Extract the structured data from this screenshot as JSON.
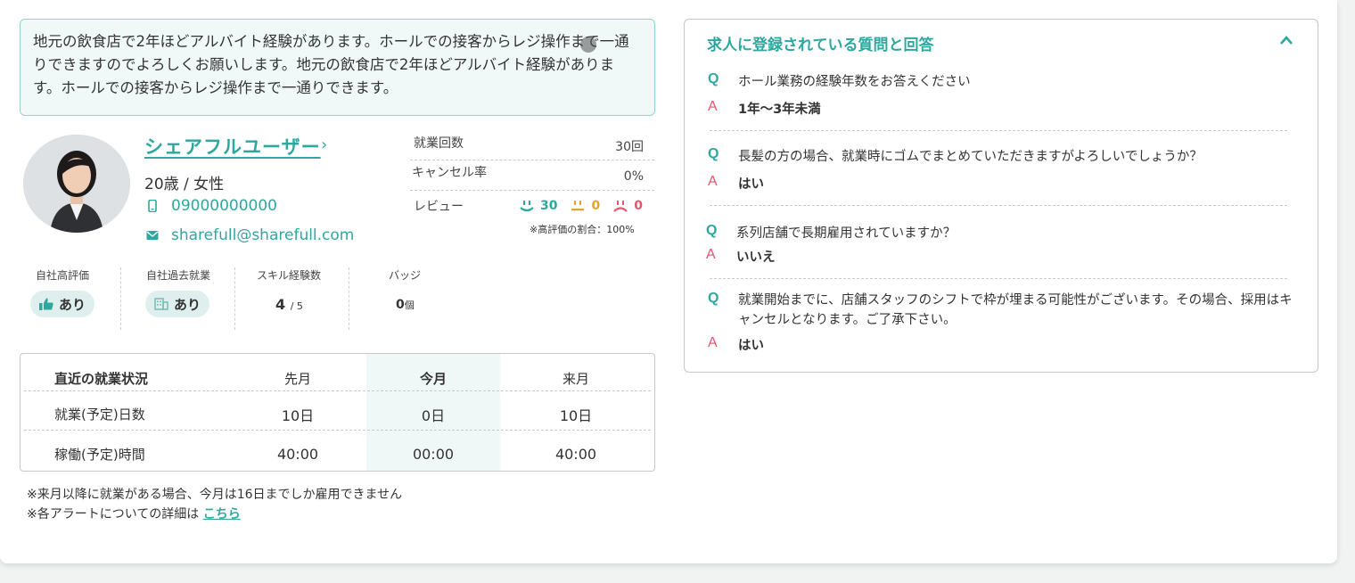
{
  "message": "地元の飲食店で2年ほどアルバイト経験があります。ホールでの接客からレジ操作まで一通りできますのでよろしくお願いします。地元の飲食店で2年ほどアルバイト経験があります。ホールでの接客からレジ操作まで一通りできます。",
  "profile": {
    "name": "シェアフルユーザー",
    "age_gender": "20歳 / 女性",
    "phone": "09000000000",
    "email": "sharefull@sharefull.com"
  },
  "stats": {
    "work_count_label": "就業回数",
    "work_count_value": "30回",
    "cancel_label": "キャンセル率",
    "cancel_value": "0%",
    "review_label": "レビュー",
    "review_good": "30",
    "review_mid": "0",
    "review_bad": "0",
    "high_ratio": "※高評価の割合：100%"
  },
  "metrics": {
    "high_eval_label": "自社高評価",
    "high_eval_value": "あり",
    "past_work_label": "自社過去就業",
    "past_work_value": "あり",
    "skill_label": "スキル経験数",
    "skill_value": "4",
    "skill_total": "/ 5",
    "badge_label": "バッジ",
    "badge_value": "0",
    "badge_unit": "個"
  },
  "work_table": {
    "title": "直近の就業状況",
    "columns": [
      "先月",
      "今月",
      "来月"
    ],
    "rows": [
      {
        "label": "就業(予定)日数",
        "values": [
          "10日",
          "0日",
          "10日"
        ]
      },
      {
        "label": "稼働(予定)時間",
        "values": [
          "40:00",
          "00:00",
          "40:00"
        ]
      }
    ]
  },
  "notes": {
    "line1": "※来月以降に就業がある場合、今月は16日までしか雇用できません",
    "line2": "※各アラートについての詳細は ",
    "link": "こちら"
  },
  "qa": {
    "title": "求人に登録されている質問と回答",
    "q_mark": "Q",
    "a_mark": "A",
    "items": [
      {
        "q": "ホール業務の経験年数をお答えください",
        "a": "1年〜3年未満"
      },
      {
        "q": "長髪の方の場合、就業時にゴムでまとめていただきますがよろしいでしょうか？",
        "a": "はい"
      },
      {
        "q": "系列店舗で長期雇用されていますか？",
        "a": "いいえ"
      },
      {
        "q": "就業開始までに、店舗スタッフのシフトで枠が埋まる可能性がございます。その場合、採用はキャンセルとなります。ご了承下さい。",
        "a": "はい"
      }
    ]
  },
  "colors": {
    "accent": "#2ea79f",
    "warn": "#e3a32c",
    "bad": "#e8546b"
  }
}
